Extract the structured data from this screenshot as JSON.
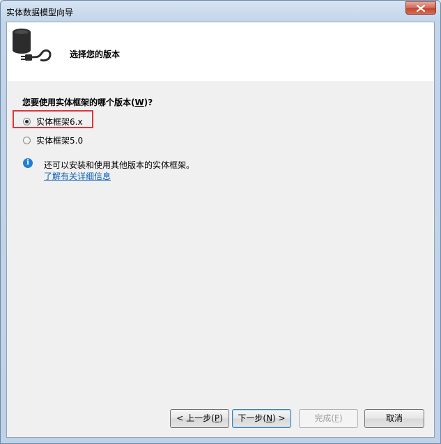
{
  "window": {
    "title": "实体数据模型向导"
  },
  "header": {
    "title": "选择您的版本",
    "icon": "database-plug-icon"
  },
  "main": {
    "question_prefix": "您要使用实体框架的哪个版本(",
    "question_mnemonic": "W",
    "question_suffix": ")?",
    "options": [
      {
        "label": "实体框架6.x",
        "selected": true,
        "highlighted": true
      },
      {
        "label": "实体框架5.0",
        "selected": false,
        "highlighted": false
      }
    ],
    "info_text": "还可以安装和使用其他版本的实体框架。",
    "info_link": "了解有关详细信息",
    "highlight_color": "#e0343b"
  },
  "buttons": {
    "back": {
      "prefix": "< 上一步(",
      "mnemonic": "P",
      "suffix": ")"
    },
    "next": {
      "prefix": "下一步(",
      "mnemonic": "N",
      "suffix": ") >"
    },
    "finish": {
      "prefix": "完成(",
      "mnemonic": "F",
      "suffix": ")"
    },
    "cancel": {
      "label": "取消"
    }
  }
}
